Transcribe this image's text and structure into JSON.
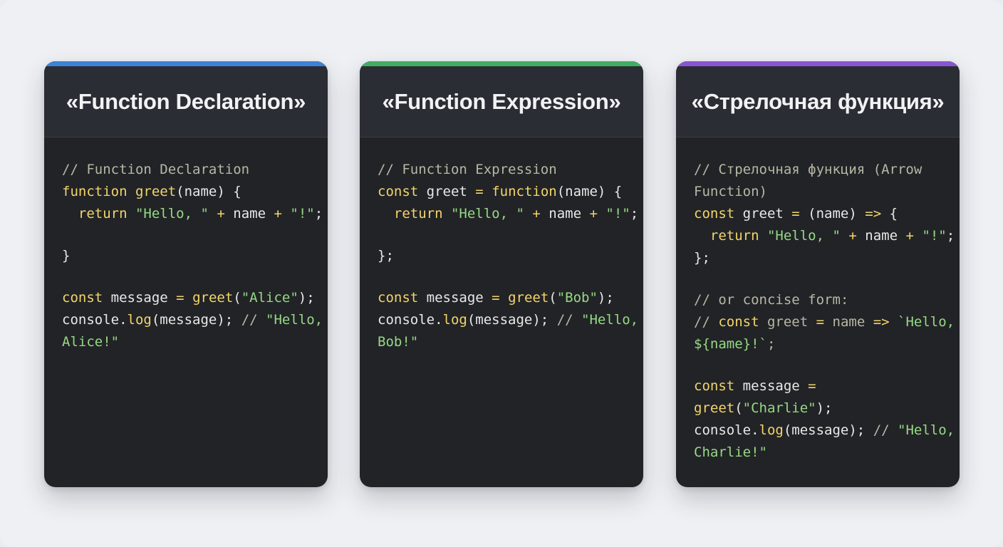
{
  "colors": {
    "accent_1": "#3d82d6",
    "accent_2": "#3fae63",
    "accent_3": "#8a55d2",
    "card_bg": "#222326",
    "header_bg": "#2a2d33",
    "comment": "#b7b7a6",
    "keyword": "#f2d56b",
    "string": "#95d985",
    "plain": "#e8e8e8"
  },
  "cards": [
    {
      "title": "«Function Declaration»",
      "lines": [
        [
          {
            "t": "c",
            "v": "// Function Declaration"
          }
        ],
        [
          {
            "t": "k",
            "v": "function"
          },
          {
            "t": "p",
            "v": " "
          },
          {
            "t": "k",
            "v": "greet"
          },
          {
            "t": "p",
            "v": "(name) {"
          }
        ],
        [
          {
            "t": "p",
            "v": "  "
          },
          {
            "t": "k",
            "v": "return"
          },
          {
            "t": "p",
            "v": " "
          },
          {
            "t": "s",
            "v": "\"Hello, \""
          },
          {
            "t": "p",
            "v": " "
          },
          {
            "t": "k",
            "v": "+"
          },
          {
            "t": "p",
            "v": " name "
          },
          {
            "t": "k",
            "v": "+"
          },
          {
            "t": "p",
            "v": " "
          },
          {
            "t": "s",
            "v": "\"!\""
          },
          {
            "t": "p",
            "v": ";"
          }
        ],
        [],
        [
          {
            "t": "p",
            "v": "}"
          }
        ],
        [],
        [
          {
            "t": "k",
            "v": "const"
          },
          {
            "t": "p",
            "v": " message "
          },
          {
            "t": "k",
            "v": "="
          },
          {
            "t": "p",
            "v": " "
          },
          {
            "t": "k",
            "v": "greet"
          },
          {
            "t": "p",
            "v": "("
          },
          {
            "t": "s",
            "v": "\"Alice\""
          },
          {
            "t": "p",
            "v": ");"
          }
        ],
        [
          {
            "t": "p",
            "v": "console."
          },
          {
            "t": "k",
            "v": "log"
          },
          {
            "t": "p",
            "v": "(message); "
          },
          {
            "t": "c",
            "v": "// "
          },
          {
            "t": "s",
            "v": "\"Hello,"
          }
        ],
        [
          {
            "t": "s",
            "v": "Alice!\""
          }
        ]
      ]
    },
    {
      "title": "«Function Expression»",
      "lines": [
        [
          {
            "t": "c",
            "v": "// Function Expression"
          }
        ],
        [
          {
            "t": "k",
            "v": "const"
          },
          {
            "t": "p",
            "v": " greet "
          },
          {
            "t": "k",
            "v": "="
          },
          {
            "t": "p",
            "v": " "
          },
          {
            "t": "k",
            "v": "function"
          },
          {
            "t": "p",
            "v": "(name) {"
          }
        ],
        [
          {
            "t": "p",
            "v": "  "
          },
          {
            "t": "k",
            "v": "return"
          },
          {
            "t": "p",
            "v": " "
          },
          {
            "t": "s",
            "v": "\"Hello, \""
          },
          {
            "t": "p",
            "v": " "
          },
          {
            "t": "k",
            "v": "+"
          },
          {
            "t": "p",
            "v": " name "
          },
          {
            "t": "k",
            "v": "+"
          },
          {
            "t": "p",
            "v": " "
          },
          {
            "t": "s",
            "v": "\"!\""
          },
          {
            "t": "p",
            "v": ";"
          }
        ],
        [],
        [
          {
            "t": "p",
            "v": "};"
          }
        ],
        [],
        [
          {
            "t": "k",
            "v": "const"
          },
          {
            "t": "p",
            "v": " message "
          },
          {
            "t": "k",
            "v": "="
          },
          {
            "t": "p",
            "v": " "
          },
          {
            "t": "k",
            "v": "greet"
          },
          {
            "t": "p",
            "v": "("
          },
          {
            "t": "s",
            "v": "\"Bob\""
          },
          {
            "t": "p",
            "v": ");"
          }
        ],
        [
          {
            "t": "p",
            "v": "console."
          },
          {
            "t": "k",
            "v": "log"
          },
          {
            "t": "p",
            "v": "(message); "
          },
          {
            "t": "c",
            "v": "// "
          },
          {
            "t": "s",
            "v": "\"Hello,"
          }
        ],
        [
          {
            "t": "s",
            "v": "Bob!\""
          }
        ]
      ]
    },
    {
      "title": "«Стрелочная функция»",
      "lines": [
        [
          {
            "t": "c",
            "v": "// Стрелочная функция (Arrow"
          }
        ],
        [
          {
            "t": "c",
            "v": "Function)"
          }
        ],
        [
          {
            "t": "k",
            "v": "const"
          },
          {
            "t": "p",
            "v": " greet "
          },
          {
            "t": "k",
            "v": "="
          },
          {
            "t": "p",
            "v": " (name) "
          },
          {
            "t": "k",
            "v": "=>"
          },
          {
            "t": "p",
            "v": " {"
          }
        ],
        [
          {
            "t": "p",
            "v": "  "
          },
          {
            "t": "k",
            "v": "return"
          },
          {
            "t": "p",
            "v": " "
          },
          {
            "t": "s",
            "v": "\"Hello, \""
          },
          {
            "t": "p",
            "v": " "
          },
          {
            "t": "k",
            "v": "+"
          },
          {
            "t": "p",
            "v": " name "
          },
          {
            "t": "k",
            "v": "+"
          },
          {
            "t": "p",
            "v": " "
          },
          {
            "t": "s",
            "v": "\"!\""
          },
          {
            "t": "p",
            "v": ";"
          }
        ],
        [
          {
            "t": "p",
            "v": "};"
          }
        ],
        [],
        [
          {
            "t": "c",
            "v": "// or concise form:"
          }
        ],
        [
          {
            "t": "c",
            "v": "// "
          },
          {
            "t": "k",
            "v": "const"
          },
          {
            "t": "c",
            "v": " greet "
          },
          {
            "t": "k",
            "v": "="
          },
          {
            "t": "c",
            "v": " name "
          },
          {
            "t": "k",
            "v": "=>"
          },
          {
            "t": "c",
            "v": " "
          },
          {
            "t": "s",
            "v": "`Hello,"
          }
        ],
        [
          {
            "t": "s",
            "v": "${name}!`"
          },
          {
            "t": "c",
            "v": ";"
          }
        ],
        [],
        [
          {
            "t": "k",
            "v": "const"
          },
          {
            "t": "p",
            "v": " message "
          },
          {
            "t": "k",
            "v": "="
          }
        ],
        [
          {
            "t": "k",
            "v": "greet"
          },
          {
            "t": "p",
            "v": "("
          },
          {
            "t": "s",
            "v": "\"Charlie\""
          },
          {
            "t": "p",
            "v": ");"
          }
        ],
        [
          {
            "t": "p",
            "v": "console."
          },
          {
            "t": "k",
            "v": "log"
          },
          {
            "t": "p",
            "v": "(message); "
          },
          {
            "t": "c",
            "v": "// "
          },
          {
            "t": "s",
            "v": "\"Hello,"
          }
        ],
        [
          {
            "t": "s",
            "v": "Charlie!\""
          }
        ]
      ]
    }
  ]
}
